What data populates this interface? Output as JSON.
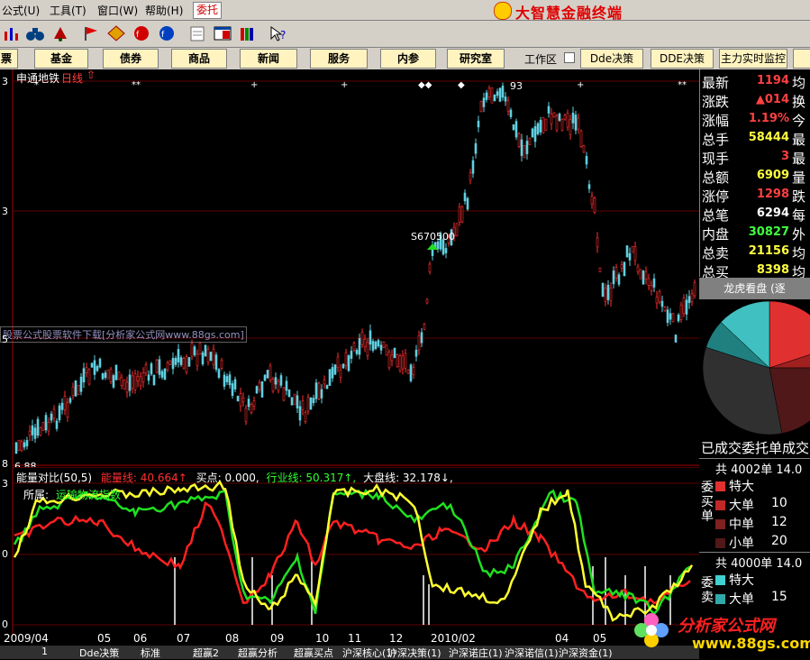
{
  "menu": {
    "items": [
      "公式(U)",
      "工具(T)",
      "窗口(W)",
      "帮助(H)"
    ],
    "entrust": "委托",
    "brand": "大智慧金融终端"
  },
  "nav": {
    "buttons": [
      "基金",
      "债券",
      "商品",
      "新闻",
      "服务",
      "内参",
      "研究室"
    ],
    "workspace": "工作区",
    "dde": [
      "Dde决策",
      "DDE决策",
      "主力实时监控"
    ]
  },
  "main": {
    "stock": "申通地铁",
    "period": "日线",
    "signal_label": "S670500",
    "watermark_text": "股票公式股票软件下载[分析家公式网www.88gs.com]",
    "high_label": "93",
    "low_label": "6.88",
    "axis_marks": [
      "3",
      "3",
      "5",
      "8"
    ]
  },
  "sub": {
    "title": "能量对比(50,5)",
    "energy": "能量线: 40.664↑",
    "buy": "买点: 0.000,",
    "industry": "行业线: 50.317↑,",
    "market": "大盘线: 32.178↓,",
    "belong": "所属:",
    "sector": "运输物流指数",
    "axis_marks": [
      "3",
      "0",
      "0"
    ]
  },
  "quote": {
    "rows": [
      {
        "label": "最新",
        "value": "1194",
        "color": "#ff4040",
        "ext": "均"
      },
      {
        "label": "涨跌",
        "value": "▲014",
        "color": "#ff4040",
        "ext": "换"
      },
      {
        "label": "涨幅",
        "value": "1.19%",
        "color": "#ff4040",
        "ext": "今"
      },
      {
        "label": "总手",
        "value": "58444",
        "color": "#ffff40",
        "ext": "最"
      },
      {
        "label": "现手",
        "value": "3",
        "color": "#ff4040",
        "ext": "最"
      },
      {
        "label": "总额",
        "value": "6909",
        "color": "#ffff40",
        "ext": "量"
      },
      {
        "label": "涨停",
        "value": "1298",
        "color": "#ff4040",
        "ext": "跌"
      },
      {
        "label": "总笔",
        "value": "6294",
        "color": "#ffffff",
        "ext": "每"
      },
      {
        "label": "内盘",
        "value": "30827",
        "color": "#40ff40",
        "ext": "外"
      },
      {
        "label": "总卖",
        "value": "21156",
        "color": "#ffff40",
        "ext": "均"
      },
      {
        "label": "总买",
        "value": "8398",
        "color": "#ffff40",
        "ext": "均"
      }
    ]
  },
  "dragon": {
    "title": "龙虎看盘 (逐",
    "done": "已成交委托单成交"
  },
  "orders": {
    "buy": {
      "total": "共 4002单 14.0",
      "side": "委买单",
      "rows": [
        {
          "label": "特大",
          "value": "",
          "color": "#e03030"
        },
        {
          "label": "大单",
          "value": "10",
          "color": "#c02828"
        },
        {
          "label": "中单",
          "value": "12",
          "color": "#802020"
        },
        {
          "label": "小单",
          "value": "20",
          "color": "#501818"
        }
      ]
    },
    "sell": {
      "total": "共 4000单 14.0",
      "side": "委卖",
      "rows": [
        {
          "label": "特大",
          "value": "",
          "color": "#40d0d0"
        },
        {
          "label": "大单",
          "value": "15",
          "color": "#30a8a8"
        }
      ]
    }
  },
  "months": [
    "2009/04",
    "05",
    "06",
    "07",
    "08",
    "09",
    "10",
    "11",
    "12",
    "2010/02",
    "04",
    "05"
  ],
  "tabs": [
    "1",
    "Dde决策",
    "标准",
    "超赢2",
    "超赢分析",
    "超赢买点",
    "沪深核心(1)",
    "沪深决策(1)",
    "沪深诺庄(1)",
    "沪深诺信(1)",
    "沪深资金(1)"
  ],
  "watermark": {
    "t1": "分析家公式网",
    "t2": "www.88gs.com"
  },
  "colors": {
    "up": "#ff3030",
    "down": "#60d0e0",
    "energy": "#ff2020",
    "industry": "#20e020",
    "market": "#ffff30"
  }
}
